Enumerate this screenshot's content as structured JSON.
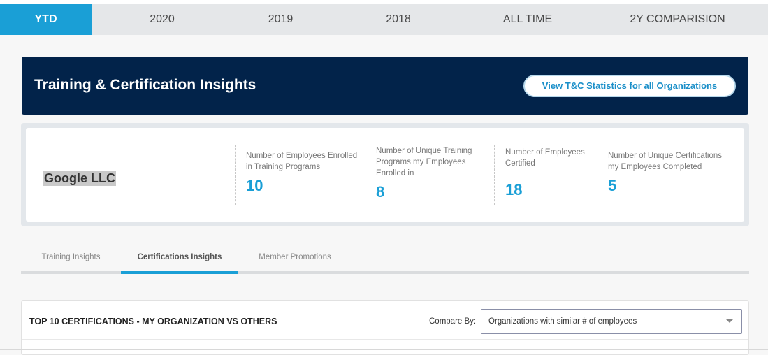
{
  "period_tabs": [
    "YTD",
    "2020",
    "2019",
    "2018",
    "ALL TIME",
    "2Y COMPARISION"
  ],
  "banner": {
    "title": "Training & Certification Insights",
    "button": "View T&C Statistics for all Organizations"
  },
  "org": {
    "name": "Google LLC"
  },
  "stats": [
    {
      "label": "Number of Employees Enrolled in Training Programs",
      "value": "10"
    },
    {
      "label": "Number of Unique Training Programs my Employees Enrolled in",
      "value": "8"
    },
    {
      "label": "Number of Employees Certified",
      "value": "18"
    },
    {
      "label": "Number of Unique Certifications my Employees Completed",
      "value": "5"
    }
  ],
  "insight_tabs": [
    "Training Insights",
    "Certifications Insights",
    "Member Promotions"
  ],
  "panel": {
    "title": "TOP 10 CERTIFICATIONS - MY ORGANIZATION VS OTHERS",
    "compare_label": "Compare By:",
    "compare_value": "Organizations with similar # of employees"
  },
  "colors": {
    "accent": "#1a9fd6",
    "banner": "#02234a"
  }
}
